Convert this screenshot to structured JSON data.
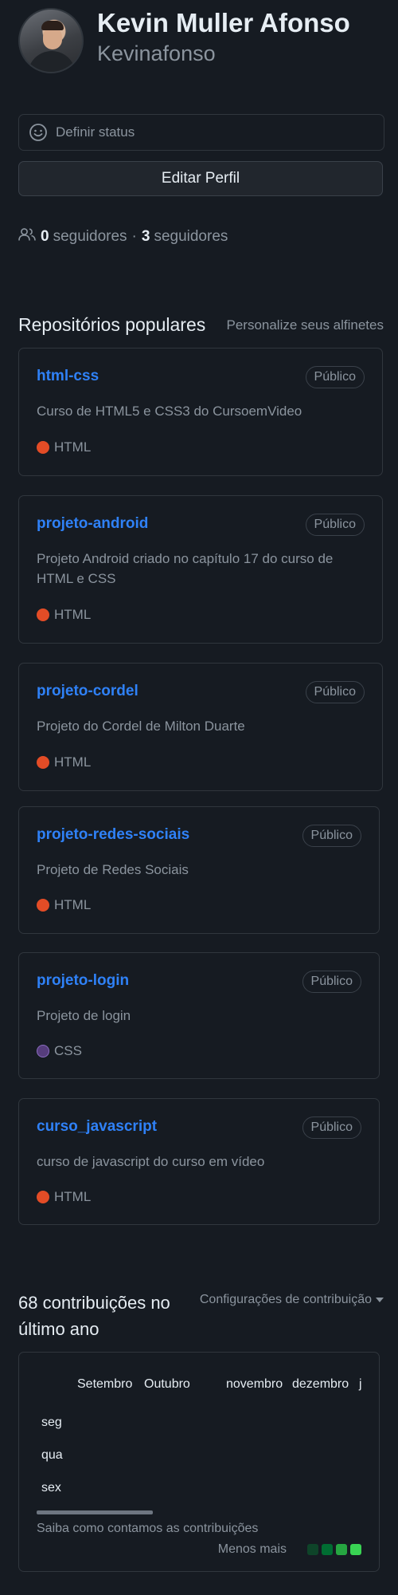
{
  "profile": {
    "name": "Kevin Muller Afonso",
    "username": "Kevinafonso",
    "status_label": "Definir status",
    "edit_label": "Editar Perfil",
    "followers_count": "0",
    "followers_label": "seguidores",
    "separator": "·",
    "following_count": "3",
    "following_label": "seguidores"
  },
  "popular": {
    "title": "Repositórios populares",
    "customize_label": "Personalize seus alfinetes",
    "repos": [
      {
        "name": "html-css",
        "visibility": "Público",
        "description": "Curso de HTML5 e CSS3 do CursoemVideo",
        "language": "HTML",
        "language_color": "#e34c26"
      },
      {
        "name": "projeto-android",
        "visibility": "Público",
        "description": "Projeto Android criado no capítulo 17 do curso de HTML e CSS",
        "language": "HTML",
        "language_color": "#e34c26"
      },
      {
        "name": "projeto-cordel",
        "visibility": "Público",
        "description": "Projeto do Cordel de Milton Duarte",
        "language": "HTML",
        "language_color": "#e34c26"
      },
      {
        "name": "projeto-redes-sociais",
        "visibility": "Público",
        "description": "Projeto de Redes Sociais",
        "language": "HTML",
        "language_color": "#e34c26"
      },
      {
        "name": "projeto-login",
        "visibility": "Público",
        "description": "Projeto de login",
        "language": "CSS",
        "language_color": "#563d7c"
      },
      {
        "name": "curso_javascript",
        "visibility": "Público",
        "description": "curso de javascript do curso em vídeo",
        "language": "HTML",
        "language_color": "#e34c26"
      }
    ]
  },
  "contributions": {
    "title": "68 contribuições no último ano",
    "settings_label": "Configurações de contribuição",
    "months": [
      "Setembro",
      "Outubro",
      "novembro",
      "dezembro",
      "j"
    ],
    "days": [
      "seg",
      "qua",
      "sex"
    ],
    "learn_label": "Saiba como contamos as contribuições",
    "legend_label": "Menos mais",
    "legend_colors": [
      "#0e4429",
      "#006d32",
      "#26a641",
      "#39d353"
    ]
  }
}
